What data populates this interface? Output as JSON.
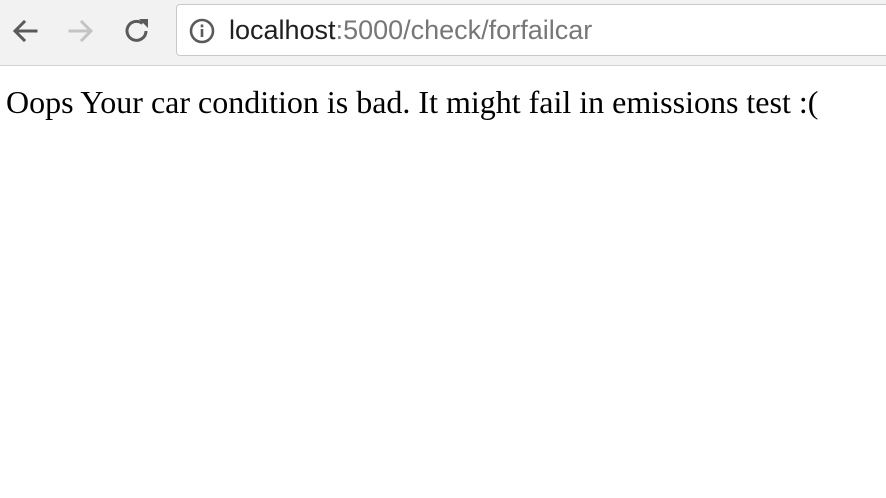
{
  "browser": {
    "url": {
      "host": "localhost",
      "path": ":5000/check/forfailcar"
    },
    "icons": {
      "back": "back-arrow-icon",
      "forward": "forward-arrow-icon",
      "reload": "reload-icon",
      "site_info": "info-icon"
    },
    "colors": {
      "toolbar": "#f2f2f2",
      "icon_active": "#5a5a5a",
      "icon_disabled": "#c4c4c4"
    }
  },
  "page": {
    "message": "Oops Your car condition is bad. It might fail in emissions test :("
  }
}
